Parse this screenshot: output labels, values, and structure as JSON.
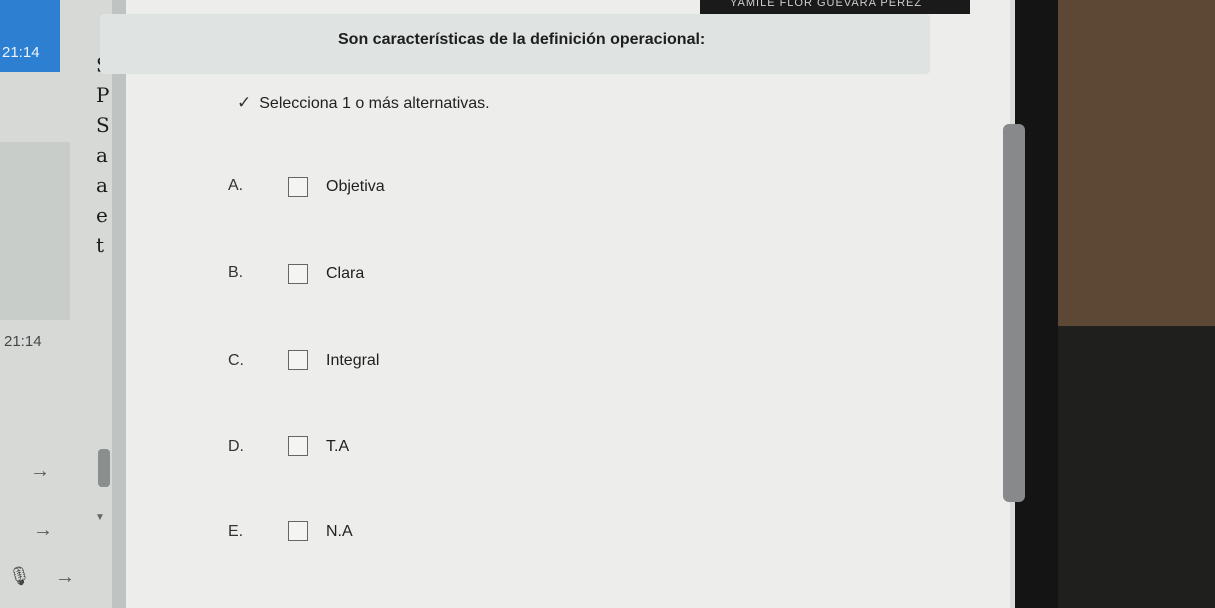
{
  "header": {
    "user_name": "YAMILE FLOR GUEVARA PEREZ"
  },
  "sidebar": {
    "time_top": "21:14",
    "time_mid": "21:14",
    "letters": [
      "S",
      "P",
      "S",
      "a",
      "a",
      "e",
      "t"
    ]
  },
  "quiz": {
    "question": "Son características de la definición operacional:",
    "instruction": "Selecciona 1 o más alternativas.",
    "options": [
      {
        "letter": "A.",
        "label": "Objetiva"
      },
      {
        "letter": "B.",
        "label": "Clara"
      },
      {
        "letter": "C.",
        "label": "Integral"
      },
      {
        "letter": "D.",
        "label": "T.A"
      },
      {
        "letter": "E.",
        "label": "N.A"
      }
    ]
  },
  "icons": {
    "check": "✓",
    "arrow": "→",
    "mic": "🎙"
  }
}
